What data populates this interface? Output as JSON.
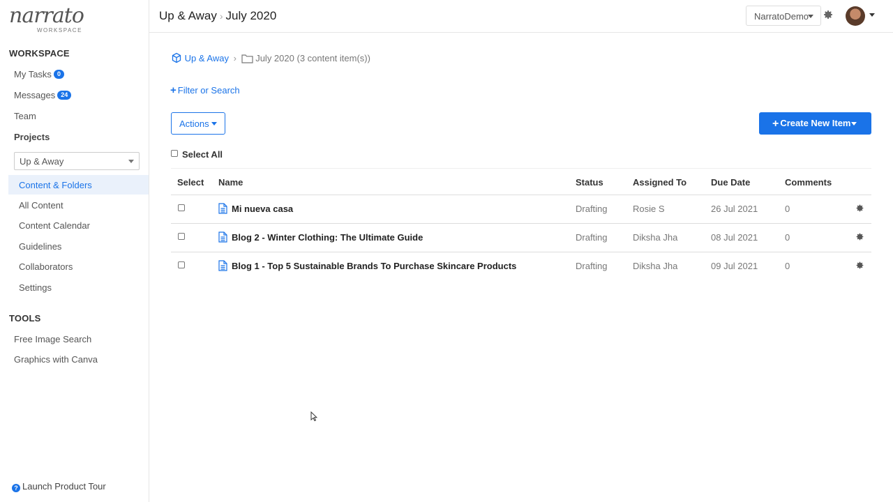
{
  "sidebar": {
    "logo": "narrato",
    "logo_sub": "WORKSPACE",
    "workspace_title": "WORKSPACE",
    "my_tasks": "My Tasks",
    "my_tasks_count": "0",
    "messages": "Messages",
    "messages_count": "24",
    "team": "Team",
    "projects_label": "Projects",
    "project_selected": "Up & Away",
    "project_nav": [
      "Content & Folders",
      "All Content",
      "Content Calendar",
      "Guidelines",
      "Collaborators",
      "Settings"
    ],
    "tools_title": "TOOLS",
    "tools": [
      "Free Image Search",
      "Graphics with Canva"
    ],
    "tour": "Launch Product Tour"
  },
  "topbar": {
    "project": "Up & Away",
    "folder": "July 2020",
    "account": "NarratoDemo"
  },
  "main": {
    "breadcrumb_project": "Up & Away",
    "breadcrumb_folder": "July 2020",
    "breadcrumb_count": "(3 content item(s))",
    "filter_link": "Filter or Search",
    "actions_label": "Actions",
    "create_label": "Create New Item",
    "select_all": "Select All",
    "columns": [
      "Select",
      "Name",
      "Status",
      "Assigned To",
      "Due Date",
      "Comments"
    ],
    "rows": [
      {
        "name": "Mi nueva casa",
        "status": "Drafting",
        "assigned": "Rosie S",
        "due": "26 Jul 2021",
        "comments": "0"
      },
      {
        "name": "Blog 2 - Winter Clothing: The Ultimate Guide",
        "status": "Drafting",
        "assigned": "Diksha Jha",
        "due": "08 Jul 2021",
        "comments": "0"
      },
      {
        "name": "Blog 1 - Top 5 Sustainable Brands To Purchase Skincare Products",
        "status": "Drafting",
        "assigned": "Diksha Jha",
        "due": "09 Jul 2021",
        "comments": "0"
      }
    ]
  },
  "colors": {
    "accent": "#1a73e8",
    "active_bg": "#eaf1fb",
    "text": "#333333",
    "muted": "#777777"
  }
}
